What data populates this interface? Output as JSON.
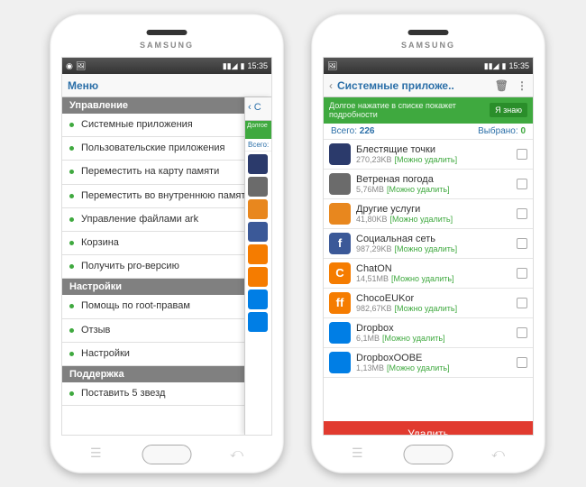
{
  "statusbar": {
    "time": "15:35"
  },
  "brand": "SAMSUNG",
  "left": {
    "title": "Меню",
    "side_title_frag": "С",
    "side_hint_frag": "Долгое",
    "side_count_frag": "Всего:",
    "sections": [
      {
        "header": "Управление",
        "items": [
          "Системные приложения",
          "Пользовательские приложения",
          "Переместить на карту памяти",
          "Переместить во внутреннюю память",
          "Управление файлами ark",
          "Корзина",
          "Получить pro-версию"
        ]
      },
      {
        "header": "Настройки",
        "items": [
          "Помощь по root-правам",
          "Отзыв",
          "Настройки"
        ]
      },
      {
        "header": "Поддержка",
        "items": [
          "Поставить 5 звезд"
        ]
      }
    ]
  },
  "right": {
    "title": "Системные приложе..",
    "hint": "Долгое нажатие в списке покажет подробности",
    "hint_button": "Я знаю",
    "total_label": "Всего:",
    "total_value": "226",
    "selected_label": "Выбрано:",
    "selected_value": "0",
    "delete_label": "Удалить",
    "apps": [
      {
        "name": "Блестящие точки",
        "size": "270,23KB",
        "status": "[Можно удалить]",
        "bg": "#2b3a6b",
        "glyph": ""
      },
      {
        "name": "Ветреная погода",
        "size": "5,76MB",
        "status": "[Можно удалить]",
        "bg": "#6b6b6b",
        "glyph": ""
      },
      {
        "name": "Другие услуги",
        "size": "41,80KB",
        "status": "[Можно удалить]",
        "bg": "#e8871e",
        "glyph": ""
      },
      {
        "name": "Социальная сеть",
        "size": "987,29KB",
        "status": "[Можно удалить]",
        "bg": "#3b5998",
        "glyph": "f"
      },
      {
        "name": "ChatON",
        "size": "14,51MB",
        "status": "[Можно удалить]",
        "bg": "#f57c00",
        "glyph": "C"
      },
      {
        "name": "ChocoEUKor",
        "size": "982,67KB",
        "status": "[Можно удалить]",
        "bg": "#f57c00",
        "glyph": "ff"
      },
      {
        "name": "Dropbox",
        "size": "6,1MB",
        "status": "[Можно удалить]",
        "bg": "#007ee5",
        "glyph": ""
      },
      {
        "name": "DropboxOOBE",
        "size": "1,13MB",
        "status": "[Можно удалить]",
        "bg": "#007ee5",
        "glyph": ""
      }
    ]
  },
  "side_icons": [
    "#2b3a6b",
    "#6b6b6b",
    "#e8871e",
    "#3b5998",
    "#f57c00",
    "#f57c00",
    "#007ee5",
    "#007ee5"
  ]
}
